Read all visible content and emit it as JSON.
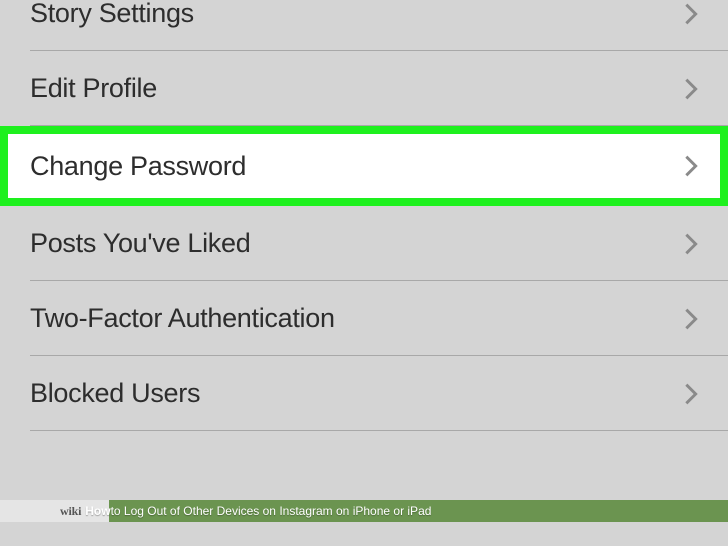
{
  "settings": {
    "items": [
      {
        "label": "Story Settings"
      },
      {
        "label": "Edit Profile"
      },
      {
        "label": "Change Password"
      },
      {
        "label": "Posts You've Liked"
      },
      {
        "label": "Two-Factor Authentication"
      },
      {
        "label": "Blocked Users"
      }
    ]
  },
  "caption": {
    "logo_prefix": "wiki",
    "bold": "How",
    "rest": " to Log Out of Other Devices on Instagram on iPhone or iPad"
  }
}
